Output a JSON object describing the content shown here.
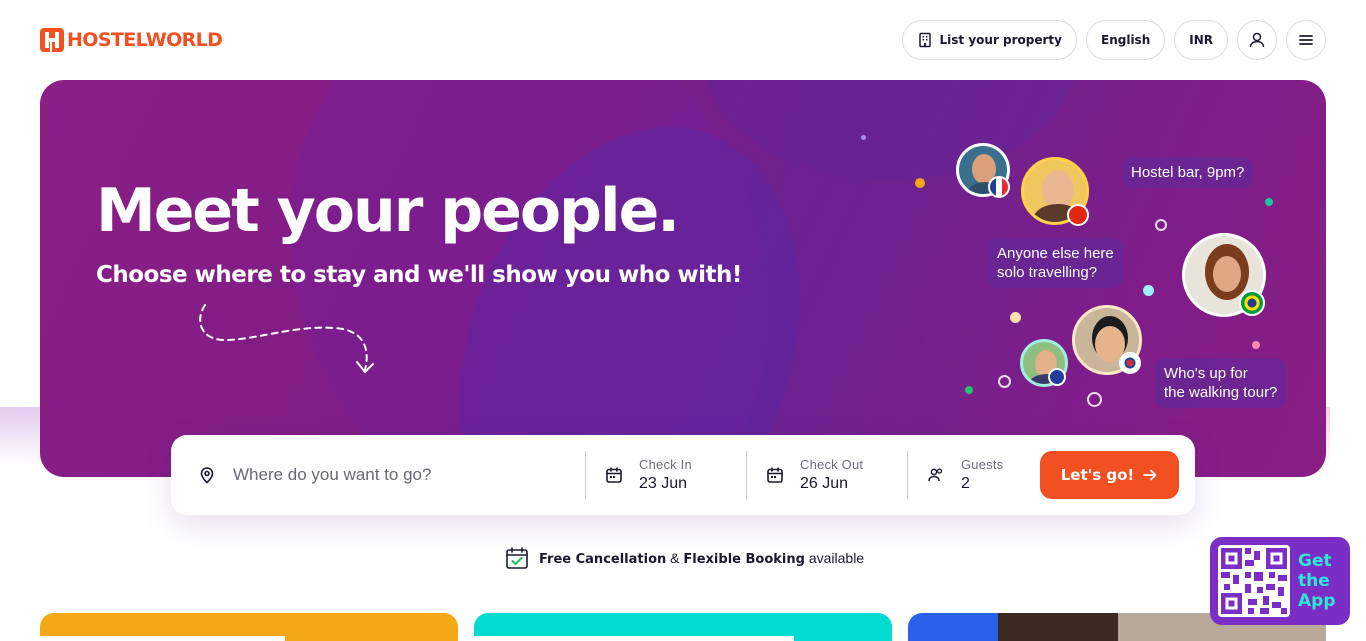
{
  "header": {
    "logo_text": "HOSTELWORLD",
    "list_property_label": "List your property",
    "language_label": "English",
    "currency_label": "INR"
  },
  "hero": {
    "headline": "Meet your people.",
    "subline": "Choose where to stay and we'll show you who with!",
    "bubbles": [
      "Hostel bar, 9pm?",
      "Anyone else here\nsolo travelling?",
      "Who's up for\nthe walking tour?"
    ]
  },
  "search": {
    "where_placeholder": "Where do you want to go?",
    "checkin_label": "Check In",
    "checkin_value": "23 Jun",
    "checkout_label": "Check Out",
    "checkout_value": "26 Jun",
    "guests_label": "Guests",
    "guests_value": "2",
    "cta_label": "Let's go!"
  },
  "promo": {
    "part1": "Free Cancellation",
    "part2": " & ",
    "part3": "Flexible Booking",
    "part4": " available"
  },
  "app_badge": {
    "line1": "Get",
    "line2": "the",
    "line3": "App"
  },
  "colors": {
    "brand": "#f25022",
    "hero": "#7e1c86",
    "card1": "#f5a815",
    "card2": "#00ddd0",
    "card3": "#2962e8"
  }
}
